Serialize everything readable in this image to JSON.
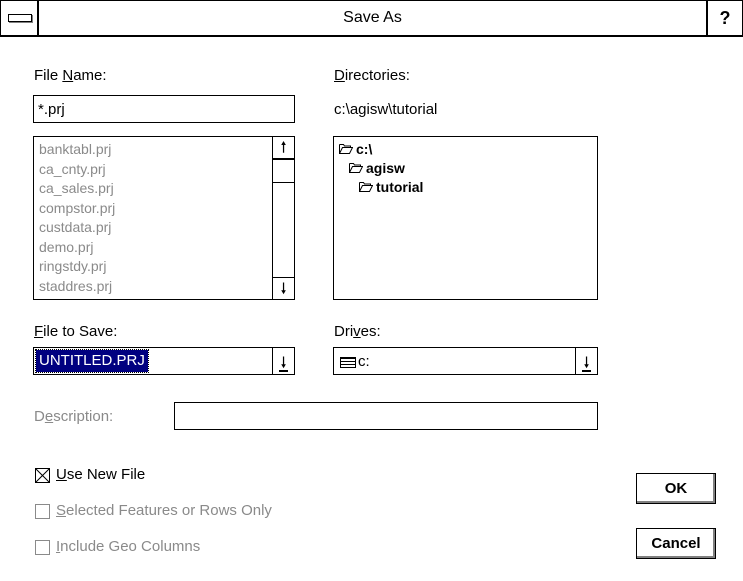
{
  "window": {
    "title": "Save As",
    "help_glyph": "?"
  },
  "file_name": {
    "label_pre": "File ",
    "label_key": "N",
    "label_post": "ame:",
    "value": "*.prj",
    "files": [
      "banktabl.prj",
      "ca_cnty.prj",
      "ca_sales.prj",
      "compstor.prj",
      "custdata.prj",
      "demo.prj",
      "ringstdy.prj",
      "staddres.prj"
    ]
  },
  "directories": {
    "label_key": "D",
    "label_post": "irectories:",
    "path": "c:\\agisw\\tutorial",
    "items": [
      {
        "name": "c:\\",
        "indent": 0
      },
      {
        "name": "agisw",
        "indent": 1
      },
      {
        "name": "tutorial",
        "indent": 2
      }
    ]
  },
  "file_to_save": {
    "label_key": "F",
    "label_post": "ile to Save:",
    "value": "UNTITLED.PRJ"
  },
  "drives": {
    "label_pre": "Dri",
    "label_key": "v",
    "label_post": "es:",
    "value": "c:"
  },
  "description": {
    "label_pre": "D",
    "label_key": "e",
    "label_post": "scription:",
    "value": ""
  },
  "options": {
    "use_new_file": {
      "label_key": "U",
      "label_post": "se New File",
      "checked": true
    },
    "selected_only": {
      "label_key": "S",
      "label_post": "elected Features or Rows Only",
      "checked": false
    },
    "include_geo": {
      "label_key": "I",
      "label_post": "nclude Geo Columns",
      "checked": false
    }
  },
  "buttons": {
    "ok": "OK",
    "cancel": "Cancel"
  }
}
